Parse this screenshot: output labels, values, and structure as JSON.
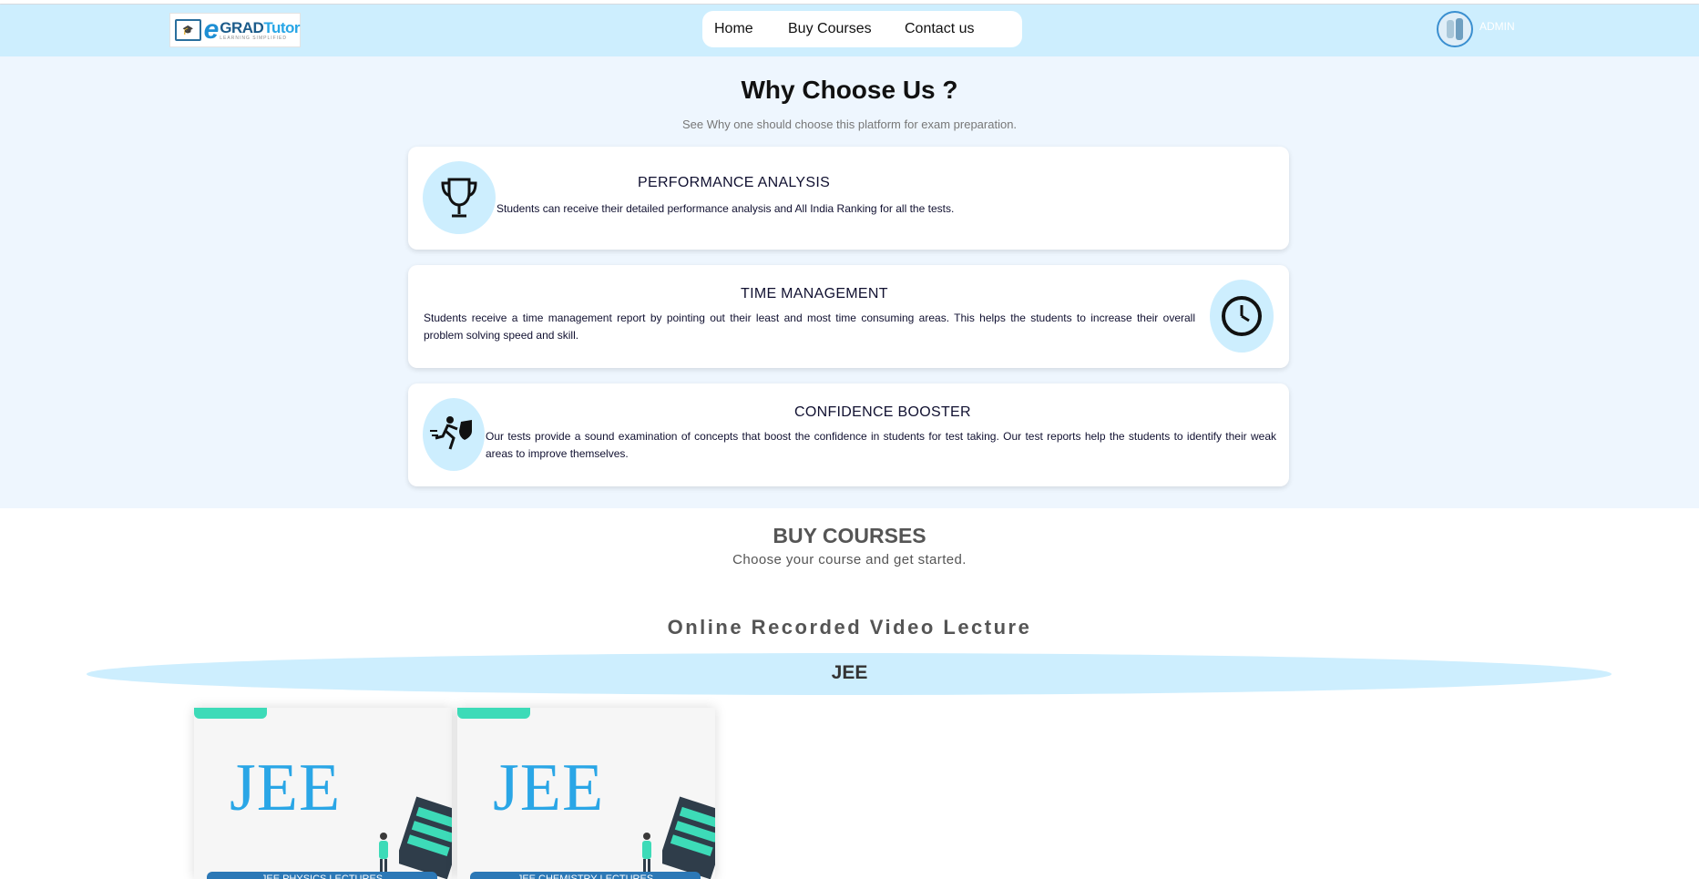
{
  "header": {
    "logo": {
      "brand_e": "e",
      "brand_grad": "GRAD",
      "brand_tutor": "Tutor",
      "tagline": "LEARNING SIMPLIFIED"
    },
    "nav": [
      {
        "label": "Home"
      },
      {
        "label": "Buy Courses"
      },
      {
        "label": "Contact us"
      }
    ],
    "user_label": "ADMIN"
  },
  "why": {
    "title": "Why Choose Us ?",
    "subtitle": "See Why one should choose this platform for exam preparation.",
    "cards": [
      {
        "title": "PERFORMANCE ANALYSIS",
        "text": "Students can receive their detailed performance analysis and All India Ranking for all the tests.",
        "icon": "trophy-icon"
      },
      {
        "title": "TIME MANAGEMENT",
        "text": "Students receive a time management report by pointing out their least and most time consuming areas. This helps the students to increase their overall problem solving speed and skill.",
        "icon": "clock-icon"
      },
      {
        "title": "CONFIDENCE BOOSTER",
        "text": "Our tests provide a sound examination of concepts that boost the confidence in students for test taking. Our test reports help the students to identify their weak areas to improve themselves.",
        "icon": "runner-shield-icon"
      }
    ]
  },
  "buy": {
    "title": "BUY COURSES",
    "subtitle": "Choose your course and get started.",
    "section_title": "Online Recorded Video Lecture",
    "category": "JEE",
    "courses": [
      {
        "thumb_text": "JEE",
        "button": "JEE PHYSICS LECTURES"
      },
      {
        "thumb_text": "JEE",
        "button": "JEE CHEMISTRY LECTURES"
      }
    ]
  },
  "colors": {
    "header_bg": "#cdeefe",
    "section_bg": "#eef6fe",
    "accent_blue": "#2aa6e6",
    "accent_green": "#3ddbb8"
  }
}
